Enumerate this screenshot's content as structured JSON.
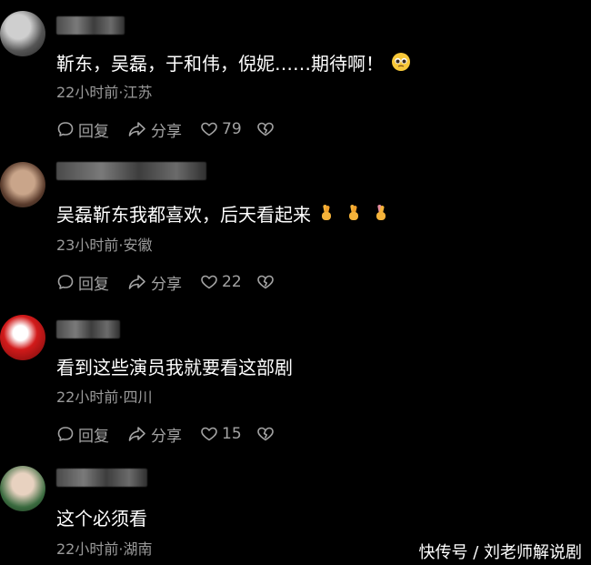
{
  "comments": [
    {
      "text": "靳东，吴磊，于和伟，倪妮……期待啊！",
      "time": "22小时前",
      "location": "江苏",
      "meta": "22小时前·江苏",
      "reply_label": "回复",
      "share_label": "分享",
      "likes": "79",
      "emoji": [
        "pleading-face"
      ]
    },
    {
      "text": "吴磊靳东我都喜欢，后天看起来",
      "time": "23小时前",
      "location": "安徽",
      "meta": "23小时前·安徽",
      "reply_label": "回复",
      "share_label": "分享",
      "likes": "22",
      "emoji": [
        "crossed-fingers",
        "crossed-fingers",
        "crossed-fingers"
      ]
    },
    {
      "text": "看到这些演员我就要看这部剧",
      "time": "22小时前",
      "location": "四川",
      "meta": "22小时前·四川",
      "reply_label": "回复",
      "share_label": "分享",
      "likes": "15"
    },
    {
      "text": "这个必须看",
      "time": "22小时前",
      "location": "湖南",
      "meta": "22小时前·湖南"
    }
  ],
  "watermark": "快传号 / 刘老师解说剧",
  "colors": {
    "background": "#000000",
    "text": "#ffffff",
    "meta": "#9a9a9a",
    "action": "#a3a3a3"
  },
  "icons": {
    "reply": "comment-bubble-icon",
    "share": "share-arrow-icon",
    "like": "heart-icon",
    "dislike": "broken-heart-icon"
  }
}
